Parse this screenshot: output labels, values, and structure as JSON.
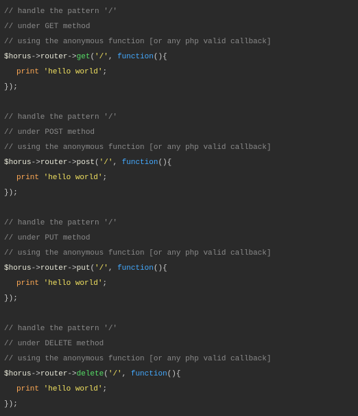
{
  "code": {
    "blocks": [
      {
        "comments": [
          "// handle the pattern '/'",
          "// under GET method",
          "// using the anonymous function [or any php valid callback]"
        ],
        "call": {
          "variable": "$horus",
          "chain1": "router",
          "method": "get",
          "arg1": "'/'",
          "func_keyword": "function",
          "open": "(){",
          "arrow": "->"
        },
        "body": {
          "keyword": "print",
          "value": "'hello world'",
          "semi": ";"
        },
        "close": "});"
      },
      {
        "comments": [
          "// handle the pattern '/'",
          "// under POST method",
          "// using the anonymous function [or any php valid callback]"
        ],
        "call": {
          "variable": "$horus",
          "chain1": "router",
          "method": "post",
          "arg1": "'/'",
          "func_keyword": "function",
          "open": "(){",
          "arrow": "->"
        },
        "body": {
          "keyword": "print",
          "value": "'hello world'",
          "semi": ";"
        },
        "close": "});"
      },
      {
        "comments": [
          "// handle the pattern '/'",
          "// under PUT method",
          "// using the anonymous function [or any php valid callback]"
        ],
        "call": {
          "variable": "$horus",
          "chain1": "router",
          "method": "put",
          "arg1": "'/'",
          "func_keyword": "function",
          "open": "(){",
          "arrow": "->"
        },
        "body": {
          "keyword": "print",
          "value": "'hello world'",
          "semi": ";"
        },
        "close": "});"
      },
      {
        "comments": [
          "// handle the pattern '/'",
          "// under DELETE method",
          "// using the anonymous function [or any php valid callback]"
        ],
        "call": {
          "variable": "$horus",
          "chain1": "router",
          "method": "delete",
          "arg1": "'/'",
          "func_keyword": "function",
          "open": "(){",
          "arrow": "->"
        },
        "body": {
          "keyword": "print",
          "value": "'hello world'",
          "semi": ";"
        },
        "close": "});"
      }
    ],
    "comma": ", ",
    "paren_open": "(",
    "blank": " "
  }
}
